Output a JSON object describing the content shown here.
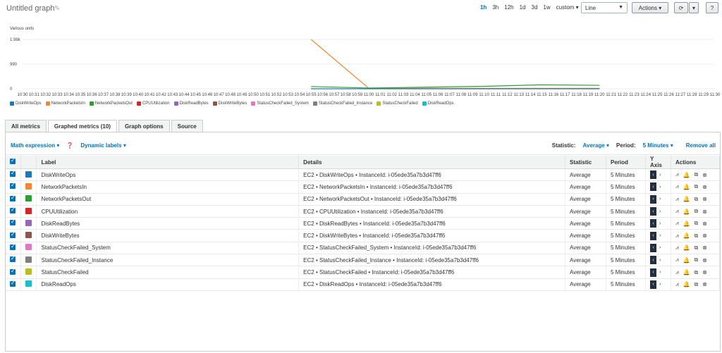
{
  "header": {
    "title": "Untitled graph",
    "time_ranges": [
      {
        "label": "1h",
        "active": true
      },
      {
        "label": "3h",
        "active": false
      },
      {
        "label": "12h",
        "active": false
      },
      {
        "label": "1d",
        "active": false
      },
      {
        "label": "3d",
        "active": false
      },
      {
        "label": "1w",
        "active": false
      },
      {
        "label": "custom ▾",
        "active": false
      }
    ],
    "chart_type": "Line",
    "actions_label": "Actions ▾",
    "refresh_icon": "refresh-icon",
    "help_label": "?"
  },
  "chart_data": {
    "type": "line",
    "ylabel": "Various units",
    "yticks": [
      "1.98k",
      "990",
      "0"
    ],
    "ylim": [
      0,
      1980
    ],
    "x": [
      "10:30",
      "10:31",
      "10:32",
      "10:33",
      "10:34",
      "10:35",
      "10:36",
      "10:37",
      "10:38",
      "10:39",
      "10:40",
      "10:41",
      "10:42",
      "10:43",
      "10:44",
      "10:45",
      "10:46",
      "10:47",
      "10:48",
      "10:49",
      "10:50",
      "10:51",
      "10:52",
      "10:53",
      "10:54",
      "10:55",
      "10:56",
      "10:57",
      "10:58",
      "10:59",
      "11:00",
      "11:01",
      "11:02",
      "11:03",
      "11:04",
      "11:05",
      "11:06",
      "11:07",
      "11:08",
      "11:09",
      "11:10",
      "11:11",
      "11:12",
      "11:13",
      "11:14",
      "11:15",
      "11:16",
      "11:17",
      "11:18",
      "11:19",
      "11:20",
      "11:21",
      "11:22",
      "11:23",
      "11:24",
      "11:25",
      "11:26",
      "11:27",
      "11:28",
      "11:29",
      "11:30"
    ],
    "series": [
      {
        "name": "NetworkPacketsIn",
        "color": "#f58536",
        "points": [
          [
            25,
            1980
          ],
          [
            30,
            20
          ],
          [
            50,
            20
          ]
        ]
      },
      {
        "name": "NetworkPacketsOut",
        "color": "#2ca02c",
        "points": [
          [
            25,
            90
          ],
          [
            30,
            30
          ],
          [
            40,
            100
          ],
          [
            45,
            160
          ],
          [
            50,
            140
          ]
        ]
      },
      {
        "name": "DiskWriteOps",
        "color": "#1f77b4",
        "points": [
          [
            25,
            0
          ],
          [
            50,
            0
          ]
        ]
      }
    ],
    "legend": [
      {
        "name": "DiskWriteOps",
        "color": "#1f77b4"
      },
      {
        "name": "NetworkPacketsIn",
        "color": "#f58536"
      },
      {
        "name": "NetworkPacketsOut",
        "color": "#2ca02c"
      },
      {
        "name": "CPUUtilization",
        "color": "#d62728"
      },
      {
        "name": "DiskReadBytes",
        "color": "#9467bd"
      },
      {
        "name": "DiskWriteBytes",
        "color": "#8c564b"
      },
      {
        "name": "StatusCheckFailed_System",
        "color": "#e377c2"
      },
      {
        "name": "StatusCheckFailed_Instance",
        "color": "#7f7f7f"
      },
      {
        "name": "StatusCheckFailed",
        "color": "#bcbd22"
      },
      {
        "name": "DiskReadOps",
        "color": "#17becf"
      }
    ]
  },
  "tabs": [
    "All metrics",
    "Graphed metrics (10)",
    "Graph options",
    "Source"
  ],
  "toolbar": {
    "math_expression": "Math expression ▾",
    "dynamic_labels": "Dynamic labels ▾",
    "statistic_label": "Statistic:",
    "statistic_value": "Average ▾",
    "period_label": "Period:",
    "period_value": "5 Minutes ▾",
    "remove_all": "Remove all"
  },
  "table": {
    "headers": [
      "Label",
      "Details",
      "Statistic",
      "Period",
      "Y Axis",
      "Actions"
    ],
    "rows": [
      {
        "label": "DiskWriteOps",
        "color": "#1f77b4",
        "details": "EC2 • DiskWriteOps • InstanceId: i-05ede35a7b3d47ff6",
        "statistic": "Average",
        "period": "5 Minutes"
      },
      {
        "label": "NetworkPacketsIn",
        "color": "#f58536",
        "details": "EC2 • NetworkPacketsIn • InstanceId: i-05ede35a7b3d47ff6",
        "statistic": "Average",
        "period": "5 Minutes"
      },
      {
        "label": "NetworkPacketsOut",
        "color": "#2ca02c",
        "details": "EC2 • NetworkPacketsOut • InstanceId: i-05ede35a7b3d47ff6",
        "statistic": "Average",
        "period": "5 Minutes"
      },
      {
        "label": "CPUUtilization",
        "color": "#d62728",
        "details": "EC2 • CPUUtilization • InstanceId: i-05ede35a7b3d47ff6",
        "statistic": "Average",
        "period": "5 Minutes"
      },
      {
        "label": "DiskReadBytes",
        "color": "#9467bd",
        "details": "EC2 • DiskReadBytes • InstanceId: i-05ede35a7b3d47ff6",
        "statistic": "Average",
        "period": "5 Minutes"
      },
      {
        "label": "DiskWriteBytes",
        "color": "#8c564b",
        "details": "EC2 • DiskWriteBytes • InstanceId: i-05ede35a7b3d47ff6",
        "statistic": "Average",
        "period": "5 Minutes"
      },
      {
        "label": "StatusCheckFailed_System",
        "color": "#e377c2",
        "details": "EC2 • StatusCheckFailed_System • InstanceId: i-05ede35a7b3d47ff6",
        "statistic": "Average",
        "period": "5 Minutes"
      },
      {
        "label": "StatusCheckFailed_Instance",
        "color": "#7f7f7f",
        "details": "EC2 • StatusCheckFailed_Instance • InstanceId: i-05ede35a7b3d47ff6",
        "statistic": "Average",
        "period": "5 Minutes"
      },
      {
        "label": "StatusCheckFailed",
        "color": "#bcbd22",
        "details": "EC2 • StatusCheckFailed • InstanceId: i-05ede35a7b3d47ff6",
        "statistic": "Average",
        "period": "5 Minutes"
      },
      {
        "label": "DiskReadOps",
        "color": "#17becf",
        "details": "EC2 • DiskReadOps • InstanceId: i-05ede35a7b3d47ff6",
        "statistic": "Average",
        "period": "5 Minutes"
      }
    ],
    "yaxis_left": "‹",
    "yaxis_right": "›",
    "actions_icons": [
      "graph-icon",
      "bell-icon",
      "copy-icon",
      "remove-icon"
    ]
  }
}
